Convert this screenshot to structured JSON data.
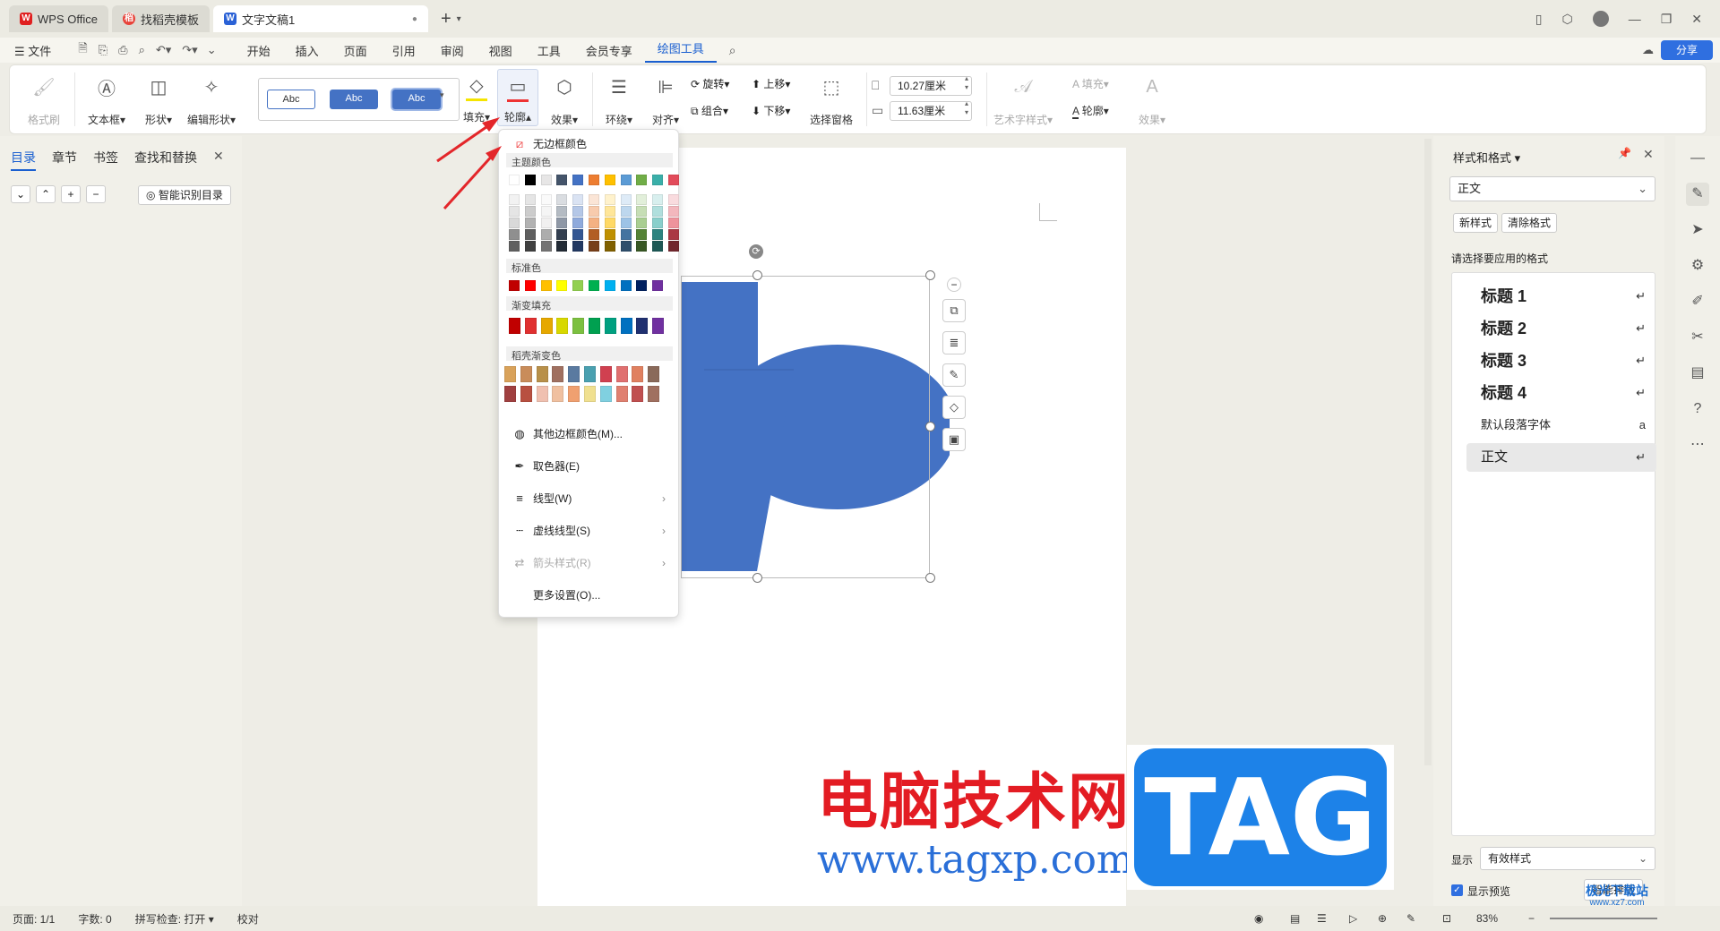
{
  "tabs": [
    {
      "label": "WPS Office",
      "icon": "wps-logo-icon"
    },
    {
      "label": "找稻壳模板",
      "icon": "daoke-logo-icon"
    },
    {
      "label": "文字文稿1",
      "icon": "word-doc-icon"
    }
  ],
  "menubar": {
    "file": "文件",
    "items": [
      "开始",
      "插入",
      "页面",
      "引用",
      "审阅",
      "视图",
      "工具",
      "会员专享",
      "绘图工具"
    ],
    "share": "分享"
  },
  "ribbon": {
    "format_painter": "格式刷",
    "textbox": "文本框",
    "shape": "形状",
    "edit_shape": "编辑形状",
    "style_samples": [
      "Abc",
      "Abc",
      "Abc"
    ],
    "fill": "填充",
    "outline": "轮廓",
    "effect": "效果",
    "wrap": "环绕",
    "align": "对齐",
    "rotate": "旋转",
    "group": "组合",
    "bring_forward": "上移",
    "send_backward": "下移",
    "selection_pane": "选择窗格",
    "width": "10.27厘米",
    "height": "11.63厘米",
    "art_text": "艺术字样式",
    "text_fill": "填充",
    "text_outline": "轮廓",
    "text_effect": "效果"
  },
  "leftpanel": {
    "tabs": [
      "目录",
      "章节",
      "书签",
      "查找和替换"
    ],
    "smart_toc": "智能识别目录"
  },
  "dropdown": {
    "no_border": "无边框颜色",
    "theme_colors": "主题颜色",
    "standard_colors": "标准色",
    "gradient_fill": "渐变填充",
    "daoke_gradient": "稻壳渐变色",
    "more_colors": "其他边框颜色(M)...",
    "eyedropper": "取色器(E)",
    "line_type": "线型(W)",
    "dash_type": "虚线线型(S)",
    "arrow_style": "箭头样式(R)",
    "more_settings": "更多设置(O)...",
    "theme_row": [
      "#ffffff",
      "#000000",
      "#e7e6e6",
      "#44546a",
      "#4472c4",
      "#ed7d31",
      "#ffc000",
      "#5b9bd5",
      "#70ad47",
      "#3aafa9",
      "#e24b5a"
    ],
    "standard_row": [
      "#c00000",
      "#ff0000",
      "#ffc000",
      "#ffff00",
      "#92d050",
      "#00b050",
      "#00b0f0",
      "#0070c0",
      "#002060",
      "#7030a0"
    ],
    "gradient_row": [
      "#c00000",
      "#e03030",
      "#e6a800",
      "#d8d800",
      "#7cc040",
      "#00a050",
      "#00a080",
      "#0070c0",
      "#203070",
      "#7030a0"
    ]
  },
  "rightpanel": {
    "title": "样式和格式",
    "current": "正文",
    "new_style": "新样式",
    "clear_format": "清除格式",
    "choose_label": "请选择要应用的格式",
    "styles": [
      "标题 1",
      "标题 2",
      "标题 3",
      "标题 4",
      "默认段落字体",
      "正文"
    ],
    "show_label": "显示",
    "show_value": "有效样式",
    "preview": "显示预览",
    "smart_layout": "智能排版"
  },
  "statusbar": {
    "page": "页面: 1/1",
    "words": "字数: 0",
    "spell": "拼写检查: 打开",
    "proof": "校对",
    "zoom": "83%"
  },
  "watermark": {
    "line1": "电脑技术网",
    "line2": "www.tagxp.com",
    "badge": "TAG",
    "corner": "极光下载站",
    "corner_url": "www.xz7.com"
  },
  "colors": {
    "accent": "#1a5fd0",
    "shape_fill": "#4472c4",
    "arrow": "#e3262a"
  }
}
